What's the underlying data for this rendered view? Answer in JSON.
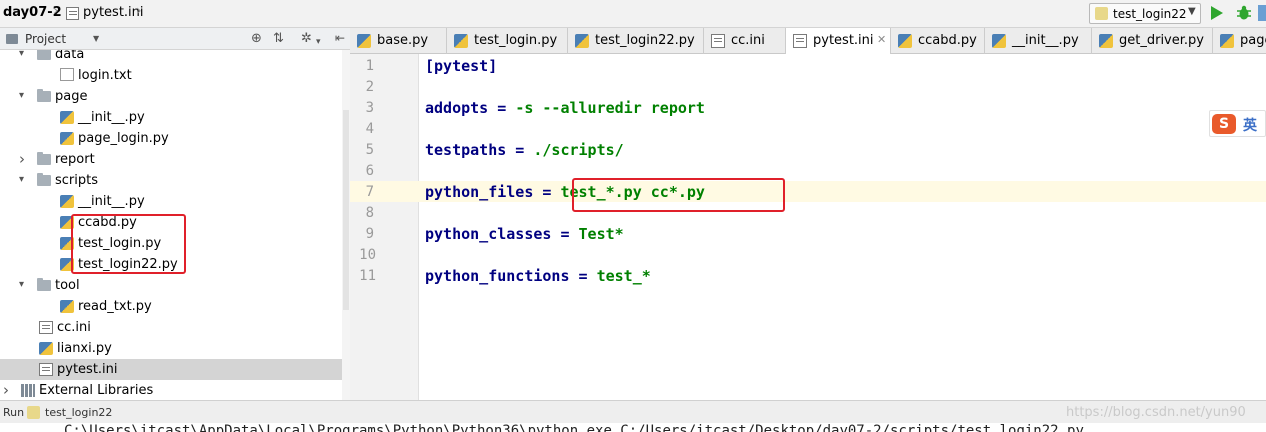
{
  "breadcrumb": {
    "project": "day07-2",
    "file": "pytest.ini"
  },
  "run_config": {
    "label": "test_login22"
  },
  "project_panel": {
    "title": "Project"
  },
  "tree": [
    {
      "label": "data",
      "type": "folder",
      "level": 1,
      "expanded": true
    },
    {
      "label": "login.txt",
      "type": "txt",
      "level": 2
    },
    {
      "label": "page",
      "type": "folder",
      "level": 1,
      "expanded": true
    },
    {
      "label": "__init__.py",
      "type": "py",
      "level": 2
    },
    {
      "label": "page_login.py",
      "type": "py",
      "level": 2
    },
    {
      "label": "report",
      "type": "folder",
      "level": 1,
      "expanded": false
    },
    {
      "label": "scripts",
      "type": "folder",
      "level": 1,
      "expanded": true
    },
    {
      "label": "__init__.py",
      "type": "py",
      "level": 2
    },
    {
      "label": "ccabd.py",
      "type": "py",
      "level": 2
    },
    {
      "label": "test_login.py",
      "type": "py",
      "level": 2
    },
    {
      "label": "test_login22.py",
      "type": "py",
      "level": 2
    },
    {
      "label": "tool",
      "type": "folder",
      "level": 1,
      "expanded": true
    },
    {
      "label": "read_txt.py",
      "type": "py",
      "level": 2
    },
    {
      "label": "cc.ini",
      "type": "ini",
      "level": 1
    },
    {
      "label": "lianxi.py",
      "type": "py",
      "level": 1
    },
    {
      "label": "pytest.ini",
      "type": "ini",
      "level": 1,
      "selected": true
    },
    {
      "label": "External Libraries",
      "type": "lib",
      "level": 0,
      "expanded": false
    }
  ],
  "tabs": [
    {
      "label": "base.py",
      "type": "py"
    },
    {
      "label": "test_login.py",
      "type": "py"
    },
    {
      "label": "test_login22.py",
      "type": "py"
    },
    {
      "label": "cc.ini",
      "type": "ini"
    },
    {
      "label": "pytest.ini",
      "type": "ini",
      "active": true
    },
    {
      "label": "ccabd.py",
      "type": "py"
    },
    {
      "label": "__init__.py",
      "type": "py"
    },
    {
      "label": "get_driver.py",
      "type": "py"
    },
    {
      "label": "page",
      "type": "py"
    }
  ],
  "editor": {
    "line_numbers": [
      "1",
      "2",
      "3",
      "4",
      "5",
      "6",
      "7",
      "8",
      "9",
      "10",
      "11"
    ],
    "lines": [
      {
        "key": "[pytest]",
        "value": ""
      },
      {
        "key": "",
        "value": ""
      },
      {
        "key": "addopts = ",
        "value": "-s --alluredir report"
      },
      {
        "key": "",
        "value": ""
      },
      {
        "key": "testpaths = ",
        "value": "./scripts/"
      },
      {
        "key": "",
        "value": ""
      },
      {
        "key": "python_files = ",
        "value": "test_*.py cc*.py"
      },
      {
        "key": "",
        "value": ""
      },
      {
        "key": "python_classes = ",
        "value": "Test*"
      },
      {
        "key": "",
        "value": ""
      },
      {
        "key": "python_functions = ",
        "value": "test_*"
      }
    ],
    "current_line": 7
  },
  "ime": {
    "logo": "S",
    "mode": "英"
  },
  "run_bar": {
    "label": "Run",
    "config": "test_login22"
  },
  "console_line": "C:\\Users\\itcast\\AppData\\Local\\Programs\\Python\\Python36\\python.exe C:/Users/itcast/Desktop/day07-2/scripts/test_login22.py",
  "watermark": "https://blog.csdn.net/yun90",
  "colors": {
    "keyword": "#000080",
    "value": "#008000",
    "highlight_box": "#e0202a",
    "current_line": "#fffae3"
  }
}
